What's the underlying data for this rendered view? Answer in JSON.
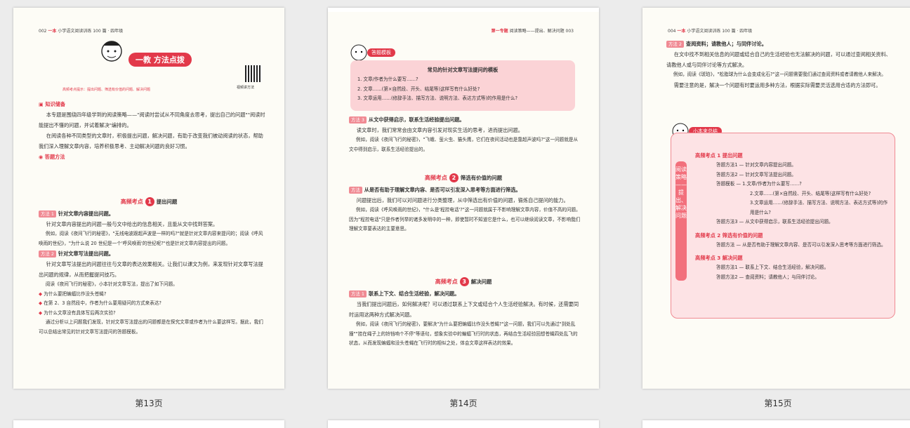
{
  "pages": [
    {
      "label": "第13页",
      "header": "002",
      "header_brand": "一本",
      "header_title": "小学语文阅读训练 100 篇 · 四年级",
      "banner_text": "一教 方法点拨",
      "banner_sub": "高频考点提示：提出问题、筛选有价值的问题、解决问题",
      "qr_caption": "视频讲方法",
      "section_knowledge": "知识储备",
      "knowledge_p1": "本专题是围绕四年级学到的阅读策略——\"阅读时尝试从不同角度去思考，提出自己的问题\"\"阅读时能提出不懂的问题，并试着解决\"编排的。",
      "knowledge_p2": "在阅读各种不同类型的文章时，积极提出问题，解决问题，有助于改变我们被动阅读的状态，帮助我们深入理解文章内容，培养积极思考、主动解决问题的良好习惯。",
      "section_method": "答题方法",
      "hf1_label": "高频考点",
      "hf1_num": "1",
      "hf1_title": "提出问题",
      "m1_tag": "方法 1",
      "m1_title": "针对文章内容提出问题。",
      "m1_p1": "针对文章内容提出的问题一般与文中给出的信息相关，且能从文中找到答案。",
      "m1_p2": "例如，阅读《夜间飞行的秘密》，\"无线电波跟超声波是一样的吗?\"就是针对文章内容来提问的；阅读《呼风唤雨的世纪》，\"为什么说 20 世纪是一个'呼风唤雨'的世纪呢?\"也是针对文章内容提出的问题。",
      "m2_tag": "方法 2",
      "m2_title": "针对文章写法提出问题。",
      "m2_p1": "针对文章写法提出的问题往往与文章的表达效果相关。让我们以课文为例，来发现针对文章写法提出问题的规律，从而把握提问技巧。",
      "m2_p2": "阅读《夜间飞行的秘密》，小本针对文章写法，提出了如下问题。",
      "bullets": [
        "为什么要把蝙蝠比作没头苍蝇?",
        "在第 2、3 自然段中，作者为什么要用疑问的方式来表达?",
        "为什么文章没有具体写后两次实验?"
      ],
      "m2_p3": "通过分析以上问题我们发现，针对文章写法提出的问题都是在探究文章或作者为什么要这样写。据此，我们可以总结出常见的针对文章写法提问的答题模板。"
    },
    {
      "label": "第14页",
      "header_sec": "第一专题",
      "header_title": "阅读策略——提出、解决问题",
      "header_num": "003",
      "template_badge": "答题模板",
      "template_title": "常见的针对文章写法提问的模板",
      "template_items": [
        "1. 文章/作者为什么要写……?",
        "2. 文章……(第×自然段、开头、结尾等)这样写有什么好处?",
        "3. 文章运用……(修辞手法、描写方法、说明方法、表达方式等)的作用是什么?"
      ],
      "m3_tag": "方法 3",
      "m3_title": "从文中获得启示，联系生活经验提出问题。",
      "m3_p1": "读文章时，我们常常会由文章内容引发对现实生活的思考，进而提出问题。",
      "m3_p2": "例如，阅读《夜间飞行的秘密》，\"飞蛾、萤火虫、猫头鹰，它们在夜间活动也是靠超声波吗?\"这一问题就是从文中得到启示，联系生活经验提出的。",
      "hf2_label": "高频考点",
      "hf2_num": "2",
      "hf2_title": "筛选有价值的问题",
      "s_tag": "方法",
      "s_title": "从是否有助于理解文章内容、是否可以引发深入思考等方面进行筛选。",
      "s_p1": "问题提出后，我们可以对问题进行分类整理，从中筛选出有价值的问题，锻炼自己提问的能力。",
      "s_p2": "例如，阅读《呼风唤雨的世纪》，\"什么是'程控电话'?\"这一问题就属于不影响理解文章内容，价值不高的问题。因为\"程控电话\"只是作者列举的诸多发明中的一种，即使暂时不知道它是什么，也可以继续阅读文章，不影响我们理解文章要表达的主要意思。",
      "hf3_label": "高频考点",
      "hf3_num": "3",
      "hf3_title": "解决问题",
      "r_tag": "方法 1",
      "r_title": "联系上下文、结合生活经验，解决问题。",
      "r_p1": "当我们提出问题后，如何解决呢？可以通过联系上下文或结合个人生活经验解决。有时候，还需要同时运用这两种方式解决问题。",
      "r_p2": "例如，阅读《夜间飞行的秘密》，要解决\"为什么要把蝙蝠比作没头苍蝇?\"这一问题，我们可以先通过\"到处乱撞\"\"挂在绳子上的铃铛响个不停\"等语句，想象实验中的蝙蝠飞行时的状态，再结合生活经验回想苍蝇四处乱飞的状态，从而发现蝙蝠和没头苍蝇在飞行时的相似之处，体会文章这样表达的效果。"
    },
    {
      "label": "第15页",
      "header": "004",
      "header_brand": "一本",
      "header_title": "小学语文阅读训练 100 篇 · 四年级",
      "m_tag": "方法 2",
      "m_title": "查阅资料；请教他人；与同伴讨论。",
      "p1": "在文中找不到相关信息的问题或结合自己的生活经验也无法解决的问题，可以通过查阅相关资料、请教他人或与同伴讨论等方式解决。",
      "p2": "例如，阅读《琥珀》，\"松脂球为什么会变成化石?\"这一问题需要我们通过查阅资料或者请教他人来解决。",
      "p3": "需要注意的是，解决一个问题有时要运用多种方法，根据实际需要灵活选用合适的方法即可。",
      "summary_title": "小本来总结",
      "vbar": "阅读策略——提出、解决问题",
      "g1": "高频考点 1  提出问题",
      "g1_items": [
        "答题方法1 — 针对文章内容提出问题。",
        "答题方法2 — 针对文章写法提出问题。",
        "答题模板 — 1.文章/作者为什么要写……?",
        "2.文章……(第×自然段、开头、结尾等)这样写有什么好处?",
        "3.文章运用……(修辞手法、描写方法、说明方法、表达方式等)的作用是什么?",
        "答题方法3 — 从文中获得启示，联系生活经验提出问题。"
      ],
      "g2": "高频考点 2  筛选有价值的问题",
      "g2_items": [
        "答题方法 — 从是否有助于理解文章内容、是否可以引发深入思考等方面进行筛选。"
      ],
      "g3": "高频考点 3  解决问题",
      "g3_items": [
        "答题方法1 — 联系上下文、结合生活经验，解决问题。",
        "答题方法2 — 查阅资料；请教他人；与同伴讨论。"
      ]
    }
  ]
}
